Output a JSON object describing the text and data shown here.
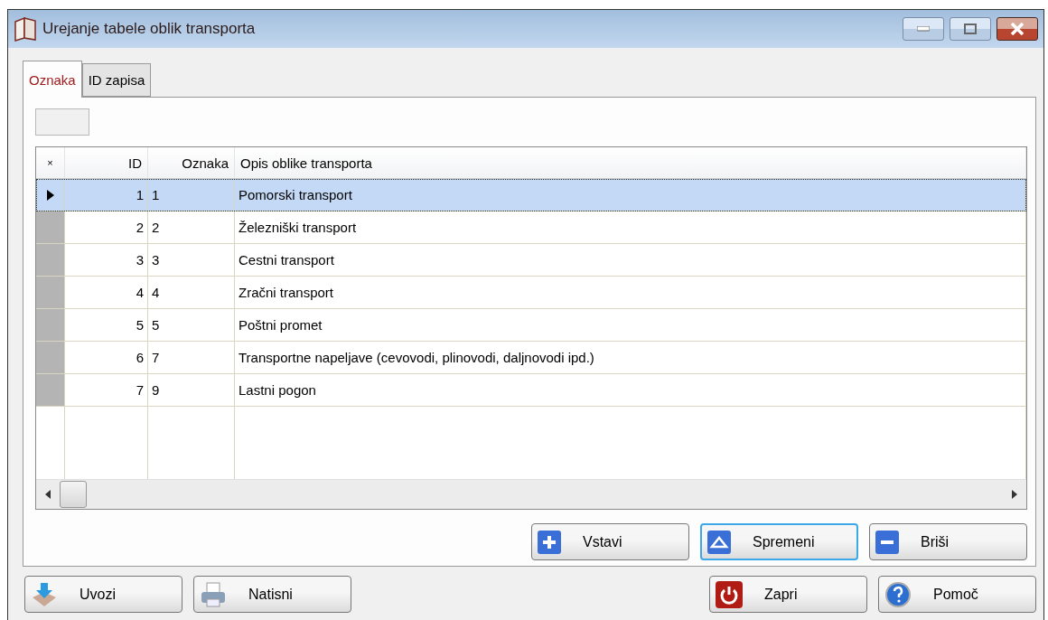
{
  "window": {
    "title": "Urejanje tabele oblik transporta"
  },
  "tabs": [
    {
      "label": "Oznaka",
      "selected": true
    },
    {
      "label": "ID zapisa",
      "selected": false
    }
  ],
  "table": {
    "corner": "×",
    "columns": [
      "ID",
      "Oznaka",
      "Opis oblike transporta"
    ],
    "rows": [
      {
        "cells": [
          "1",
          "1",
          "Pomorski transport"
        ],
        "selected": true
      },
      {
        "cells": [
          "2",
          "2",
          "Železniški transport"
        ],
        "selected": false
      },
      {
        "cells": [
          "3",
          "3",
          "Cestni transport"
        ],
        "selected": false
      },
      {
        "cells": [
          "4",
          "4",
          "Zračni transport"
        ],
        "selected": false
      },
      {
        "cells": [
          "5",
          "5",
          "Poštni promet"
        ],
        "selected": false
      },
      {
        "cells": [
          "6",
          "7",
          "Transportne napeljave (cevovodi, plinovodi, daljnovodi ipd.)"
        ],
        "selected": false
      },
      {
        "cells": [
          "7",
          "9",
          "Lastni pogon"
        ],
        "selected": false
      }
    ]
  },
  "edit_buttons": [
    {
      "label": "Vstavi",
      "kind": "plus",
      "focused": false
    },
    {
      "label": "Spremeni",
      "kind": "up",
      "focused": true
    },
    {
      "label": "Briši",
      "kind": "minus",
      "focused": false
    }
  ],
  "left_buttons": [
    {
      "label": "Uvozi",
      "kind": "import"
    },
    {
      "label": "Natisni",
      "kind": "print"
    }
  ],
  "right_buttons": [
    {
      "label": "Zapri",
      "kind": "power"
    },
    {
      "label": "Pomoč",
      "kind": "help"
    }
  ]
}
